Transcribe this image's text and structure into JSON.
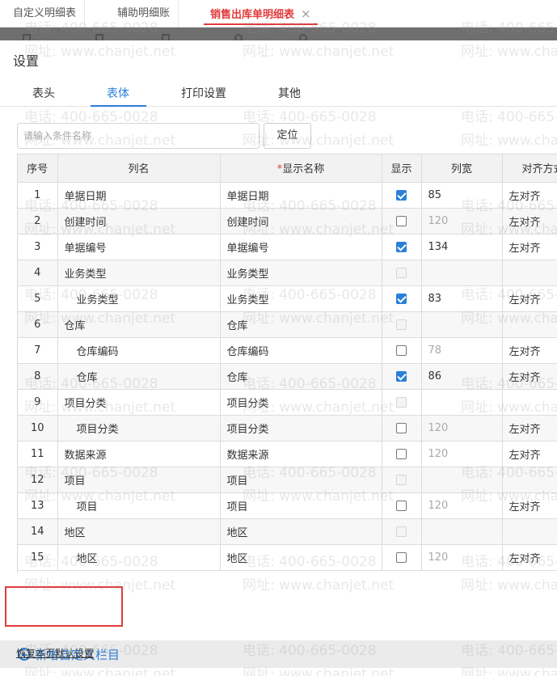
{
  "app_tabs": [
    {
      "label": "自定义明细表"
    },
    {
      "label": "辅助明细账"
    },
    {
      "label": "销售出库单明细表",
      "close": "×"
    }
  ],
  "dialog": {
    "title": "设置",
    "tabs": [
      "表头",
      "表体",
      "打印设置",
      "其他"
    ],
    "active_tab": "表体",
    "search": {
      "placeholder": "请输入条件名称",
      "button": "定位"
    },
    "columns": {
      "seq": "序号",
      "name": "列名",
      "required_mark": "*",
      "display_name": "显示名称",
      "show": "显示",
      "width": "列宽",
      "align": "对齐方式"
    },
    "rows": [
      {
        "seq": "1",
        "name": "单据日期",
        "display": "单据日期",
        "checked": "on",
        "width": "85",
        "width_dim": false,
        "align": "左对齐",
        "indent": false
      },
      {
        "seq": "2",
        "name": "创建时间",
        "display": "创建时间",
        "checked": "off",
        "width": "120",
        "width_dim": true,
        "align": "左对齐",
        "indent": false
      },
      {
        "seq": "3",
        "name": "单据编号",
        "display": "单据编号",
        "checked": "on",
        "width": "134",
        "width_dim": false,
        "align": "左对齐",
        "indent": false
      },
      {
        "seq": "4",
        "name": "业务类型",
        "display": "业务类型",
        "checked": "dis",
        "width": "",
        "width_dim": false,
        "align": "",
        "indent": false
      },
      {
        "seq": "5",
        "name": "业务类型",
        "display": "业务类型",
        "checked": "on",
        "width": "83",
        "width_dim": false,
        "align": "左对齐",
        "indent": true
      },
      {
        "seq": "6",
        "name": "仓库",
        "display": "仓库",
        "checked": "dis",
        "width": "",
        "width_dim": false,
        "align": "",
        "indent": false
      },
      {
        "seq": "7",
        "name": "仓库编码",
        "display": "仓库编码",
        "checked": "off",
        "width": "78",
        "width_dim": true,
        "align": "左对齐",
        "indent": true
      },
      {
        "seq": "8",
        "name": "仓库",
        "display": "仓库",
        "checked": "on",
        "width": "86",
        "width_dim": false,
        "align": "左对齐",
        "indent": true
      },
      {
        "seq": "9",
        "name": "项目分类",
        "display": "项目分类",
        "checked": "dis",
        "width": "",
        "width_dim": false,
        "align": "",
        "indent": false
      },
      {
        "seq": "10",
        "name": "项目分类",
        "display": "项目分类",
        "checked": "off",
        "width": "120",
        "width_dim": true,
        "align": "左对齐",
        "indent": true
      },
      {
        "seq": "11",
        "name": "数据来源",
        "display": "数据来源",
        "checked": "off",
        "width": "120",
        "width_dim": true,
        "align": "左对齐",
        "indent": false
      },
      {
        "seq": "12",
        "name": "项目",
        "display": "项目",
        "checked": "dis",
        "width": "",
        "width_dim": false,
        "align": "",
        "indent": false
      },
      {
        "seq": "13",
        "name": "项目",
        "display": "项目",
        "checked": "off",
        "width": "120",
        "width_dim": true,
        "align": "左对齐",
        "indent": true
      },
      {
        "seq": "14",
        "name": "地区",
        "display": "地区",
        "checked": "dis",
        "width": "",
        "width_dim": false,
        "align": "",
        "indent": false
      },
      {
        "seq": "15",
        "name": "地区",
        "display": "地区",
        "checked": "off",
        "width": "120",
        "width_dim": true,
        "align": "左对齐",
        "indent": true
      }
    ],
    "add_custom_column": "新增自定义栏目",
    "restore_defaults": "恢复本页默认设置"
  },
  "watermark": {
    "phone": "电话: 400-665-0028",
    "site": "网址: www.chanjet.net"
  },
  "colors": {
    "accent": "#2b7fd8",
    "active_tab": "#e23b3b",
    "highlight": "#e23b3b"
  }
}
